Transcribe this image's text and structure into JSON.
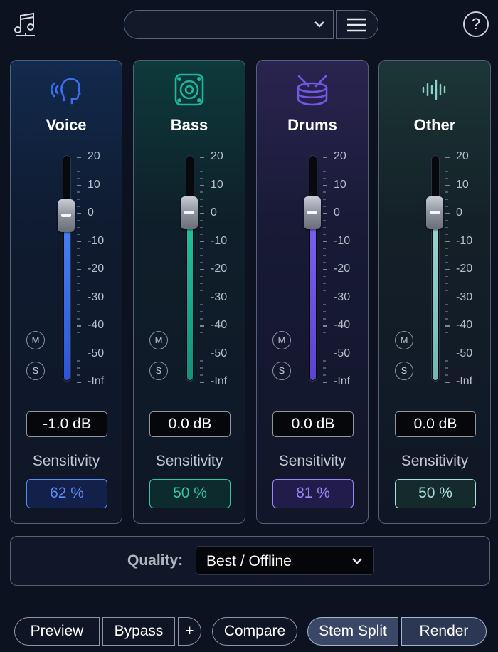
{
  "header": {
    "app_icon": "music-notes-icon",
    "preset_value": "",
    "menu_icon": "hamburger-icon",
    "help_label": "?"
  },
  "stems": [
    {
      "name": "Voice",
      "icon": "voice-head-icon",
      "accent": "#3b6ff0",
      "fill_top": "#4a82f5",
      "fill_bottom": "#2c55d6",
      "level_db": -1.0,
      "gain_label": "-1.0 dB",
      "sensitivity_label": "Sensitivity",
      "sensitivity_value": "62 %",
      "sens_color": "#5c8cf5",
      "sens_bg": "#13204a",
      "mute": "M",
      "solo": "S"
    },
    {
      "name": "Bass",
      "icon": "speaker-icon",
      "accent": "#1fb59a",
      "fill_top": "#28c2a3",
      "fill_bottom": "#12907a",
      "level_db": 0.0,
      "gain_label": "0.0 dB",
      "sensitivity_label": "Sensitivity",
      "sensitivity_value": "50 %",
      "sens_color": "#2fc6a8",
      "sens_bg": "#0d2a2c",
      "mute": "M",
      "solo": "S"
    },
    {
      "name": "Drums",
      "icon": "drum-icon",
      "accent": "#7158e6",
      "fill_top": "#7c63f0",
      "fill_bottom": "#5b43d0",
      "level_db": 0.0,
      "gain_label": "0.0 dB",
      "sensitivity_label": "Sensitivity",
      "sensitivity_value": "81 %",
      "sens_color": "#9a86f8",
      "sens_bg": "#221c4a",
      "mute": "M",
      "solo": "S"
    },
    {
      "name": "Other",
      "icon": "waveform-icon",
      "accent": "#8fd0cd",
      "fill_top": "#9bd8d4",
      "fill_bottom": "#6fb8b4",
      "level_db": 0.0,
      "gain_label": "0.0 dB",
      "sensitivity_label": "Sensitivity",
      "sensitivity_value": "50 %",
      "sens_color": "#a8e0dc",
      "sens_bg": "#142a2c",
      "mute": "M",
      "solo": "S"
    }
  ],
  "scale": [
    "20",
    "10",
    "0",
    "-10",
    "-20",
    "-30",
    "-40",
    "-50",
    "-Inf"
  ],
  "quality": {
    "label": "Quality:",
    "value": "Best / Offline"
  },
  "footer": {
    "preview": "Preview",
    "bypass": "Bypass",
    "plus": "+",
    "compare": "Compare",
    "stem_split": "Stem Split",
    "render": "Render"
  }
}
